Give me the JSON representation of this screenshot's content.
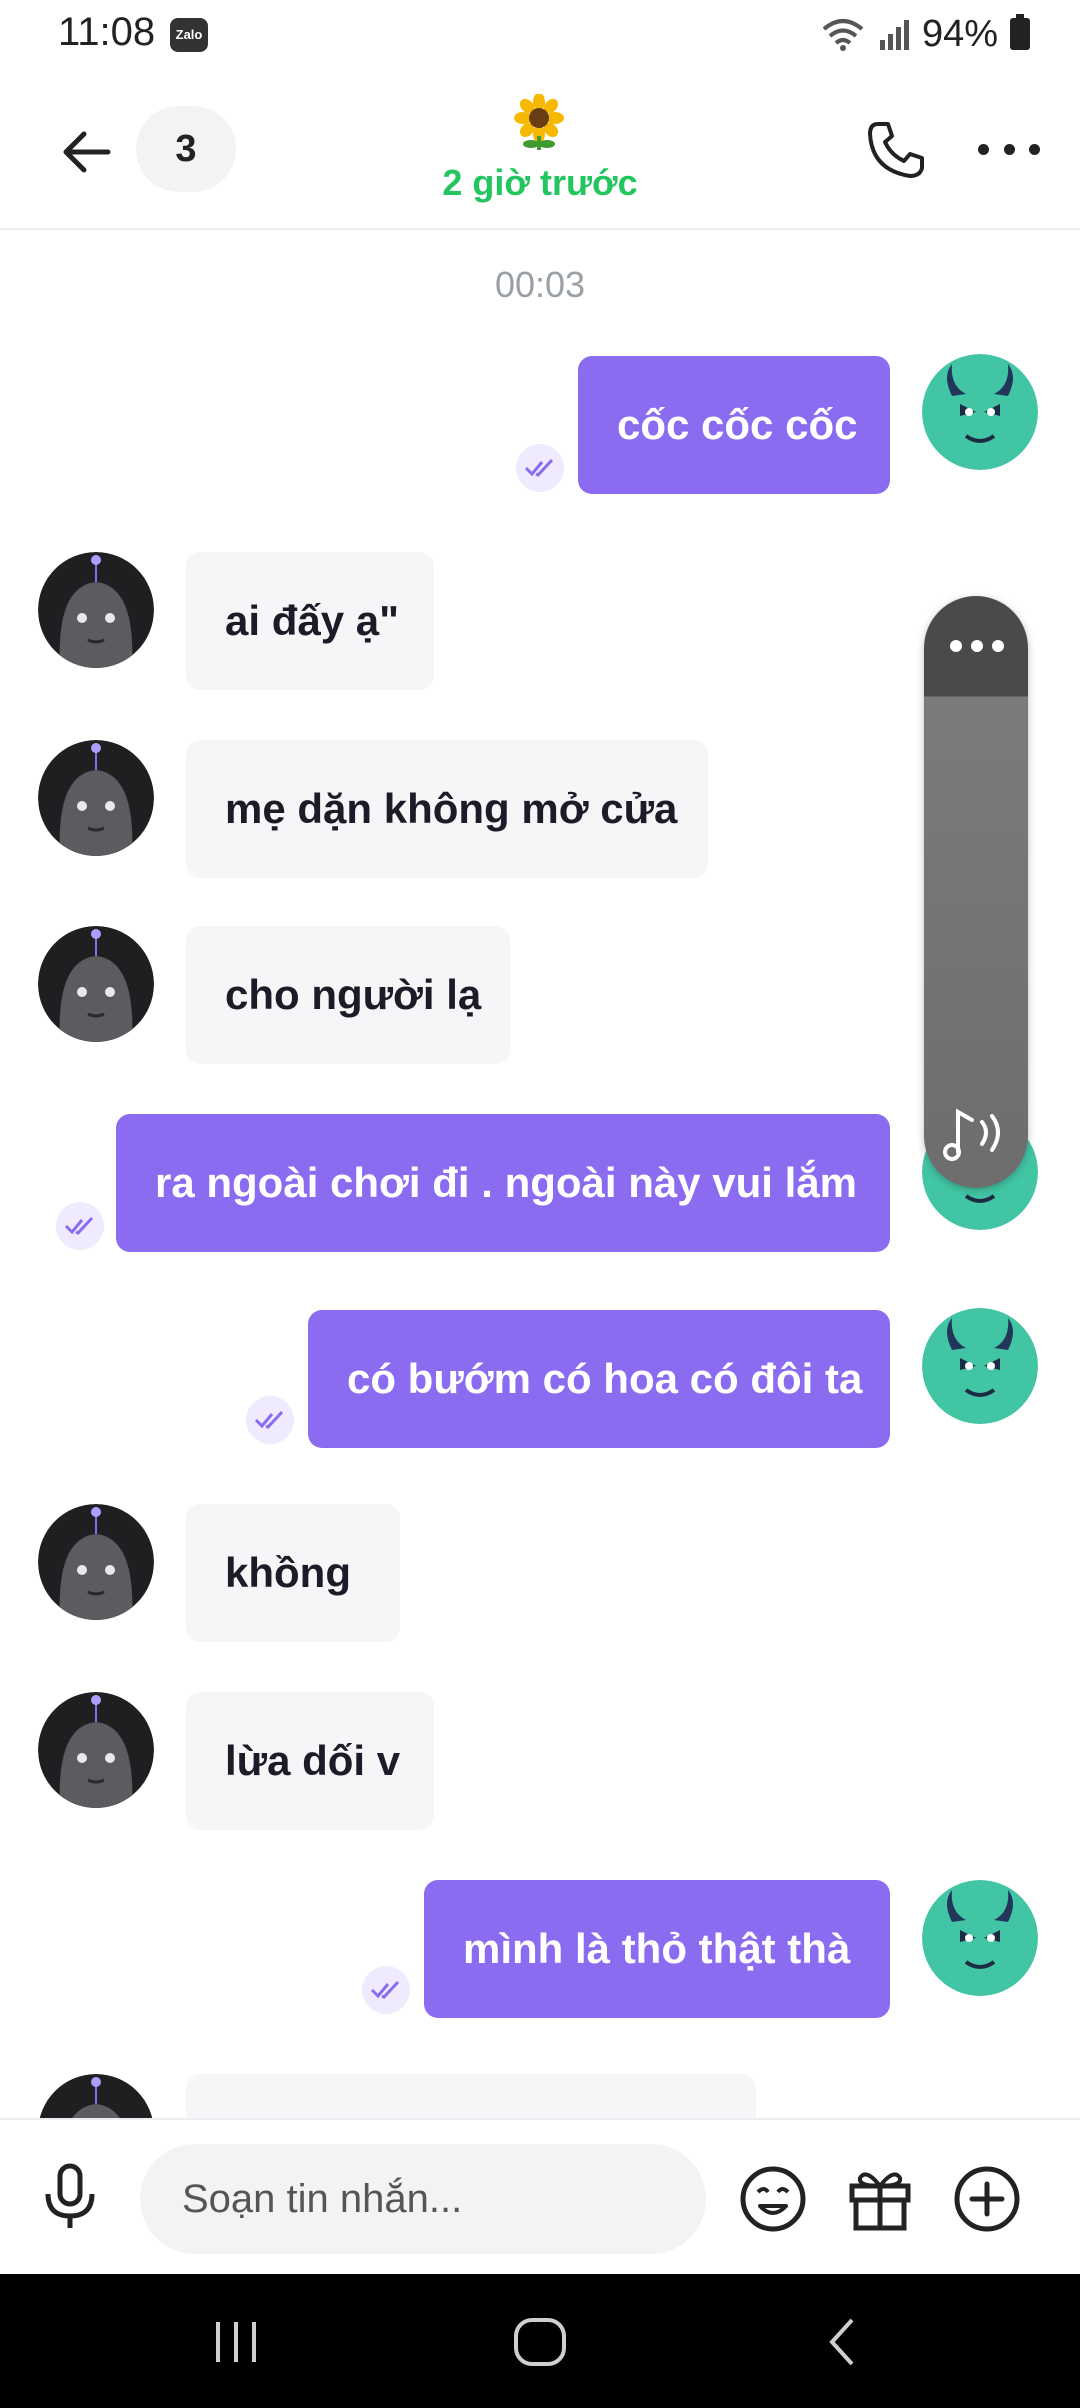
{
  "status_bar": {
    "time": "11:08",
    "app_badge": "Zalo",
    "battery": "94%"
  },
  "header": {
    "unread_count": "3",
    "subtitle": "2 giờ trước"
  },
  "chat": {
    "time_separator": "00:03",
    "messages": [
      {
        "direction": "out",
        "text": "cốc cốc cốc"
      },
      {
        "direction": "in",
        "text": "ai đấy ạ\""
      },
      {
        "direction": "in",
        "text": "mẹ dặn không mở cửa"
      },
      {
        "direction": "in",
        "text": "cho người lạ"
      },
      {
        "direction": "out",
        "text": "ra ngoài chơi đi . ngoài này vui lắm"
      },
      {
        "direction": "out",
        "text": "có bướm có hoa có đôi ta"
      },
      {
        "direction": "in",
        "text": "khồng"
      },
      {
        "direction": "in",
        "text": "lừa dối v"
      },
      {
        "direction": "out",
        "text": "mình là thỏ thật thà"
      },
      {
        "direction": "in",
        "text": ""
      }
    ]
  },
  "composer": {
    "placeholder": "Soạn tin nhắn..."
  },
  "colors": {
    "accent": "#8b6cf0",
    "subtitle_green": "#22c55e",
    "incoming_bubble": "#f5f6f8"
  },
  "icons": [
    "back-arrow-icon",
    "sunflower-icon",
    "phone-icon",
    "more-dots-icon",
    "double-check-icon",
    "music-note-icon",
    "microphone-icon",
    "emoji-icon",
    "gift-icon",
    "plus-circle-icon",
    "recent-apps-icon",
    "home-icon",
    "back-nav-icon"
  ]
}
